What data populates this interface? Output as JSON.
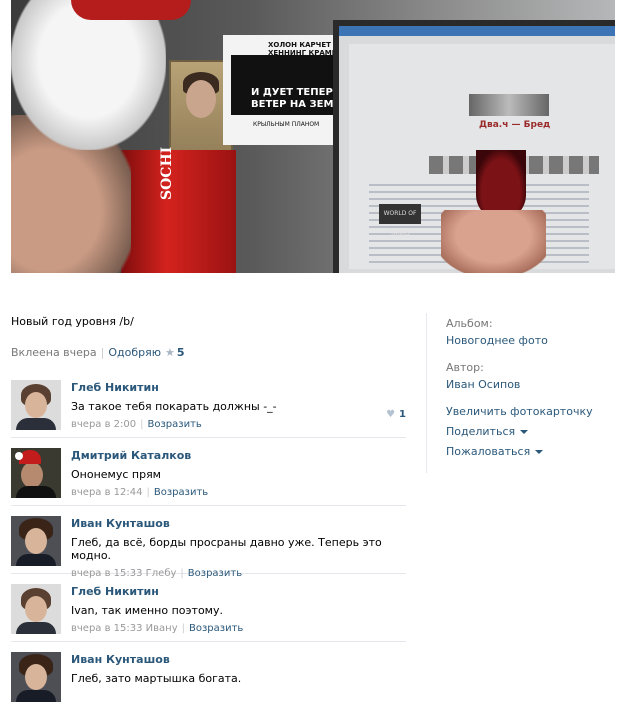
{
  "photo": {
    "poster_top_text": "ХОЛОН КАРЧЕТ\nХЕННИНГ КРАМЕР ДАЛ",
    "poster_main_text": "И ДУЕТ ТЕПЕРЬ\nВЕТЕР НА ЗЕМЛЕ",
    "poster_bottom_text": "КРЫЛЬНЫМ ПЛАНОМ",
    "can_text": "SOCHI",
    "monitor_title": "Два.ч — Бред",
    "monitor_badge": "WORLD OF TANKS"
  },
  "post": {
    "description": "Новый год уровня /b/",
    "added": "Вклеена вчера",
    "like_label": "Одобряю",
    "like_count": "5"
  },
  "comments": [
    {
      "author": "Глеб Никитин",
      "text": "За такое тебя покарать должны -_-",
      "time": "вчера в 2:00",
      "reply": "Возразить",
      "likes": "1"
    },
    {
      "author": "Дмитрий Каталков",
      "text": "Ононемус прям",
      "time": "вчера в 12:44",
      "reply": "Возразить"
    },
    {
      "author": "Иван Кунташов",
      "text": "Глеб, да всё, борды просраны давно уже. Теперь это модно.",
      "time": "вчера в 15:33 Глебу",
      "reply": "Возразить"
    },
    {
      "author": "Глеб Никитин",
      "text": "Ivan, так именно поэтому.",
      "time": "вчера в 15:33 Ивану",
      "reply": "Возразить"
    },
    {
      "author": "Иван Кунташов",
      "text": "Глеб, зато мартышка богата.",
      "time": "",
      "reply": ""
    }
  ],
  "sidebar": {
    "album_label": "Альбом:",
    "album_value": "Новогоднее фото",
    "author_label": "Автор:",
    "author_value": "Иван Осипов",
    "enlarge": "Увеличить фотокарточку",
    "share": "Поделиться",
    "report": "Пожаловаться"
  },
  "colors": {
    "link": "#2b587a",
    "muted": "#777777",
    "divider": "#e4e8ed"
  }
}
